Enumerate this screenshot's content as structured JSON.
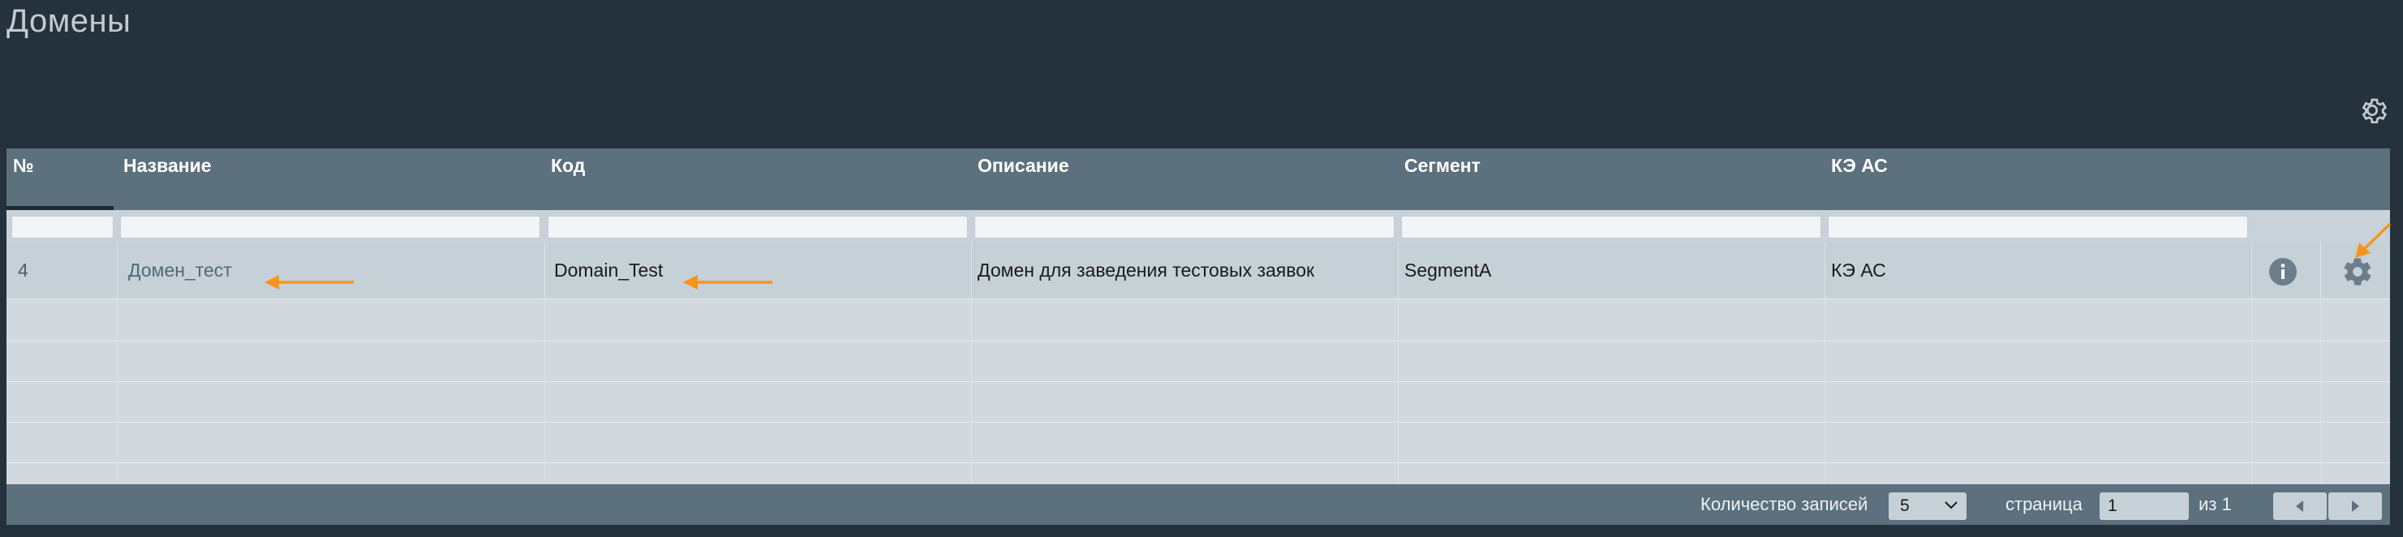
{
  "page": {
    "title": "Домены"
  },
  "grid": {
    "columns": [
      {
        "key": "num",
        "label": "№"
      },
      {
        "key": "name",
        "label": "Название"
      },
      {
        "key": "code",
        "label": "Код"
      },
      {
        "key": "description",
        "label": "Описание"
      },
      {
        "key": "segment",
        "label": "Сегмент"
      },
      {
        "key": "ke_as",
        "label": "КЭ АС"
      }
    ],
    "filters": {
      "num": "",
      "name": "",
      "code": "",
      "description": "",
      "segment": "",
      "ke_as": ""
    },
    "rows": [
      {
        "num": "4",
        "name": "Домен_тест",
        "code": "Domain_Test",
        "description": "Домен для заведения тестовых заявок",
        "segment": "SegmentA",
        "ke_as": "КЭ АС"
      }
    ],
    "row_actions": {
      "info_icon": "info-icon",
      "settings_icon": "gear-icon"
    }
  },
  "pager": {
    "records_label": "Количество записей",
    "records_per_page": "5",
    "page_label": "страница",
    "current_page": "1",
    "total_label": "из 1",
    "prev_icon": "arrow-left-icon",
    "next_icon": "arrow-right-icon"
  },
  "colors": {
    "background": "#25313b",
    "header": "#5c707e",
    "row": "#c6d0d7",
    "annotation_arrow": "#f7941d"
  }
}
